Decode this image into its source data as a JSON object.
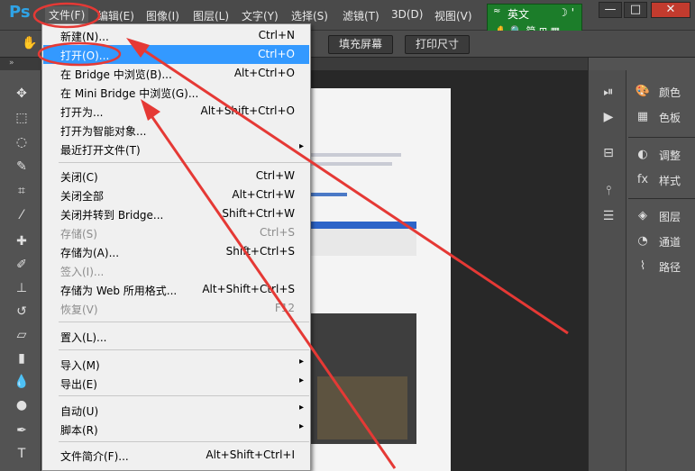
{
  "app": {
    "logo": "Ps"
  },
  "menubar": {
    "items": [
      "文件(F)",
      "编辑(E)",
      "图像(I)",
      "图层(L)",
      "文字(Y)",
      "选择(S)",
      "滤镜(T)",
      "3D(D)",
      "视图(V)"
    ]
  },
  "ime": {
    "lang": "英文",
    "tools": "✋ 🔍 简 ⊞ ▦"
  },
  "window_controls": {
    "minimize": "—",
    "maximize": "□",
    "close": "✕"
  },
  "options": {
    "fill_screen": "填充屏幕",
    "print_size": "打印尺寸"
  },
  "file_menu": {
    "items": [
      {
        "label": "新建(N)...",
        "shortcut": "Ctrl+N"
      },
      {
        "label": "打开(O)...",
        "shortcut": "Ctrl+O"
      },
      {
        "label": "在 Bridge 中浏览(B)...",
        "shortcut": "Alt+Ctrl+O"
      },
      {
        "label": "在 Mini Bridge 中浏览(G)...",
        "shortcut": ""
      },
      {
        "label": "打开为...",
        "shortcut": "Alt+Shift+Ctrl+O"
      },
      {
        "label": "打开为智能对象...",
        "shortcut": ""
      },
      {
        "label": "最近打开文件(T)",
        "shortcut": ""
      },
      {
        "label": "关闭(C)",
        "shortcut": "Ctrl+W"
      },
      {
        "label": "关闭全部",
        "shortcut": "Alt+Ctrl+W"
      },
      {
        "label": "关闭并转到 Bridge...",
        "shortcut": "Shift+Ctrl+W"
      },
      {
        "label": "存储(S)",
        "shortcut": "Ctrl+S"
      },
      {
        "label": "存储为(A)...",
        "shortcut": "Shift+Ctrl+S"
      },
      {
        "label": "签入(I)...",
        "shortcut": ""
      },
      {
        "label": "存储为 Web 所用格式...",
        "shortcut": "Alt+Shift+Ctrl+S"
      },
      {
        "label": "恢复(V)",
        "shortcut": "F12"
      },
      {
        "label": "置入(L)...",
        "shortcut": ""
      },
      {
        "label": "导入(M)",
        "shortcut": ""
      },
      {
        "label": "导出(E)",
        "shortcut": ""
      },
      {
        "label": "自动(U)",
        "shortcut": ""
      },
      {
        "label": "脚本(R)",
        "shortcut": ""
      },
      {
        "label": "文件简介(F)...",
        "shortcut": "Alt+Shift+Ctrl+I"
      }
    ]
  },
  "right_panels": {
    "items": [
      "颜色",
      "色板",
      "调整",
      "样式",
      "图层",
      "通道",
      "路径"
    ]
  },
  "colors": {
    "highlight": "#3399ff",
    "annotation": "#e53935",
    "ime_green": "#1c7d2a"
  }
}
